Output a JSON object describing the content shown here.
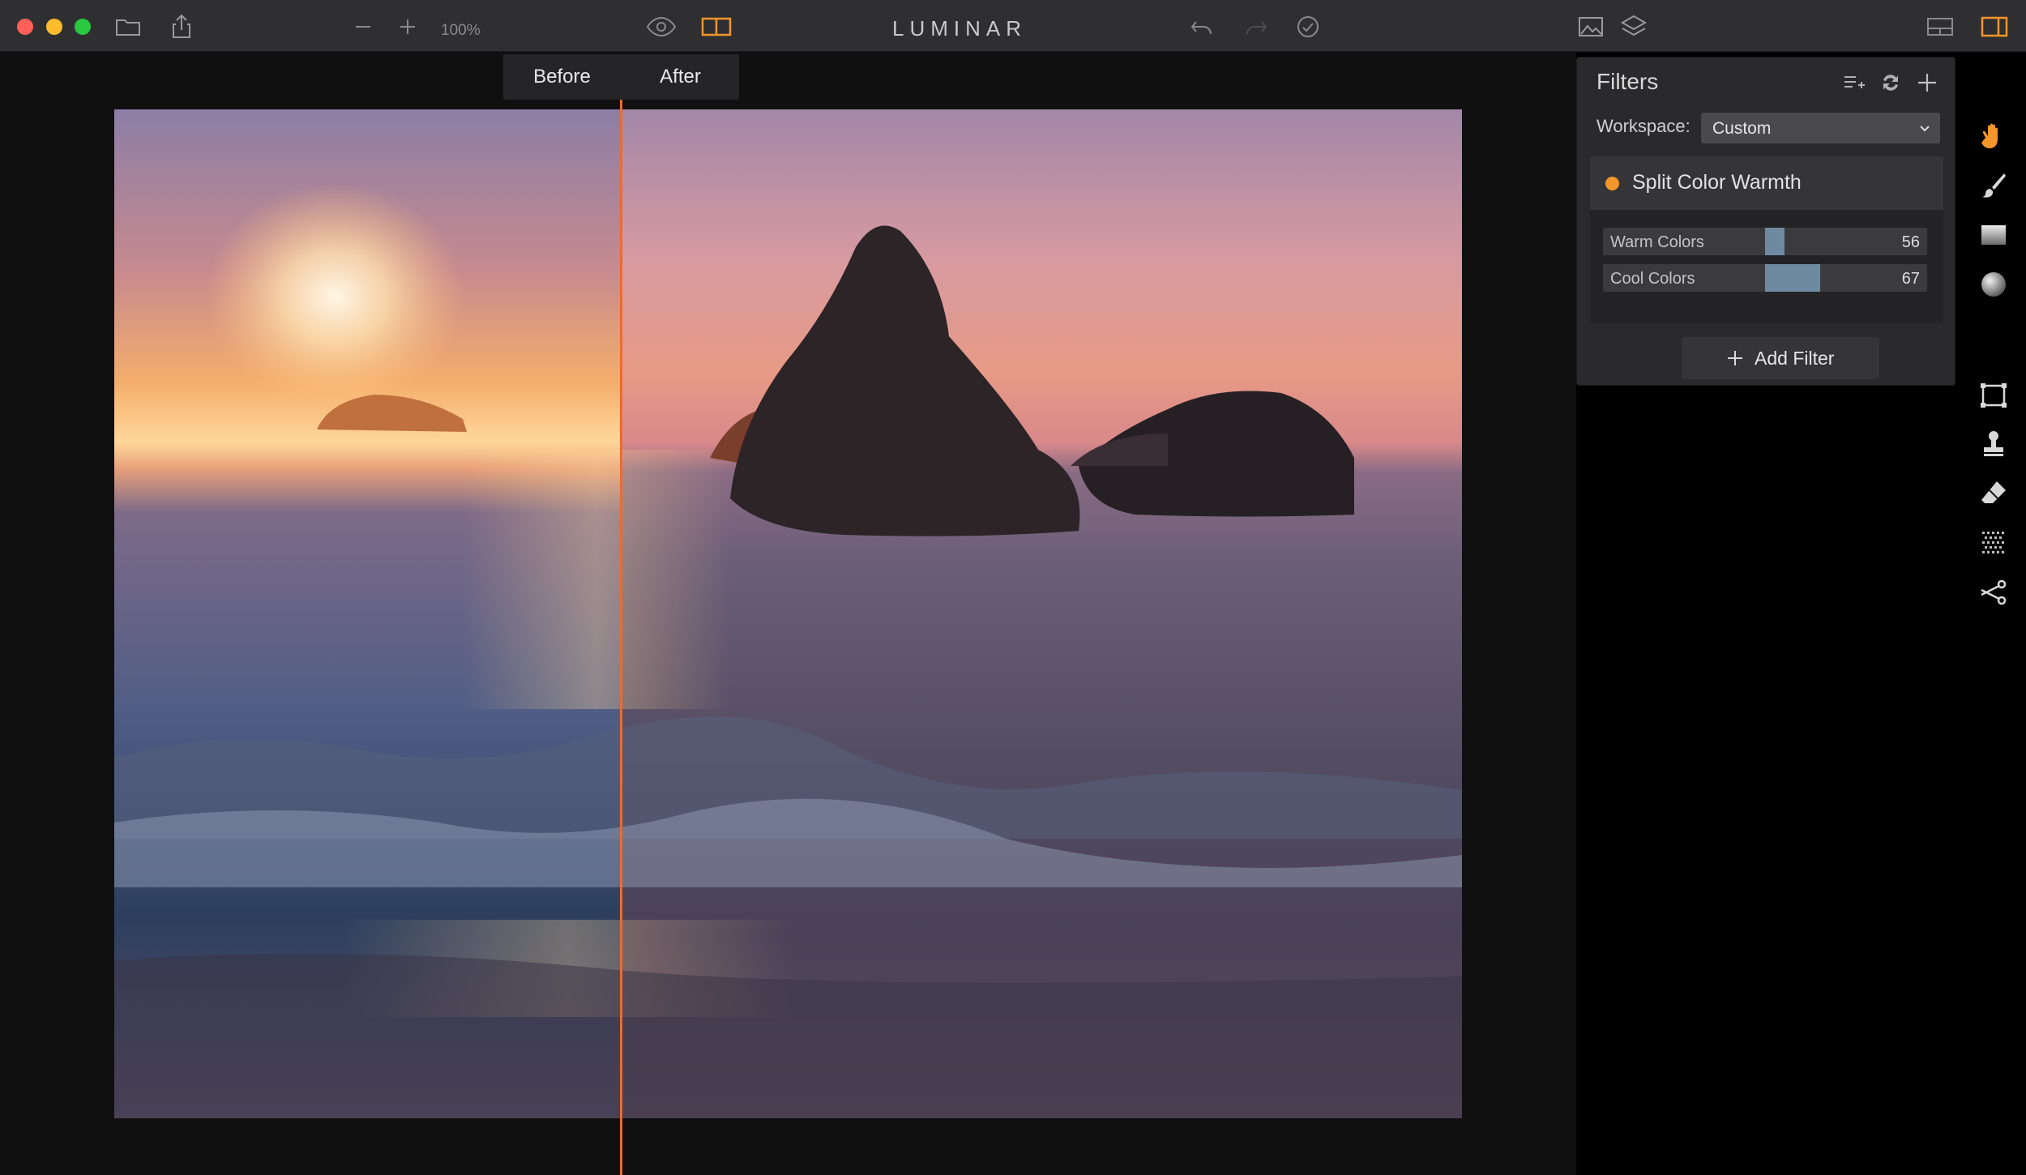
{
  "app": {
    "title": "LUMINAR"
  },
  "toolbar": {
    "zoom_level": "100%"
  },
  "compare": {
    "before_label": "Before",
    "after_label": "After"
  },
  "filters_panel": {
    "title": "Filters",
    "workspace_label": "Workspace:",
    "workspace_value": "Custom",
    "filter": {
      "name": "Split Color Warmth",
      "dot_color": "#f3962b",
      "sliders": [
        {
          "label": "Warm Colors",
          "value": 56
        },
        {
          "label": "Cool Colors",
          "value": 67
        }
      ]
    },
    "add_filter_label": "Add Filter"
  },
  "colors": {
    "accent": "#f06a2a",
    "slider_fill": "#6e8aa1",
    "close": "#fe5f57",
    "minimize": "#febc2e",
    "zoom": "#28c840"
  },
  "icons": {
    "titlebar": [
      "folder-icon",
      "share-icon",
      "zoom-out-icon",
      "zoom-in-icon",
      "eye-icon",
      "split-view-icon",
      "undo-icon",
      "redo-icon",
      "history-icon",
      "image-icon",
      "layers-icon",
      "layout-icon",
      "panel-toggle-icon"
    ],
    "tools": [
      "hand-icon",
      "brush-icon",
      "gradient-icon",
      "radial-icon",
      "crop-icon",
      "stamp-icon",
      "eraser-icon",
      "noise-icon",
      "cut-icon"
    ]
  }
}
